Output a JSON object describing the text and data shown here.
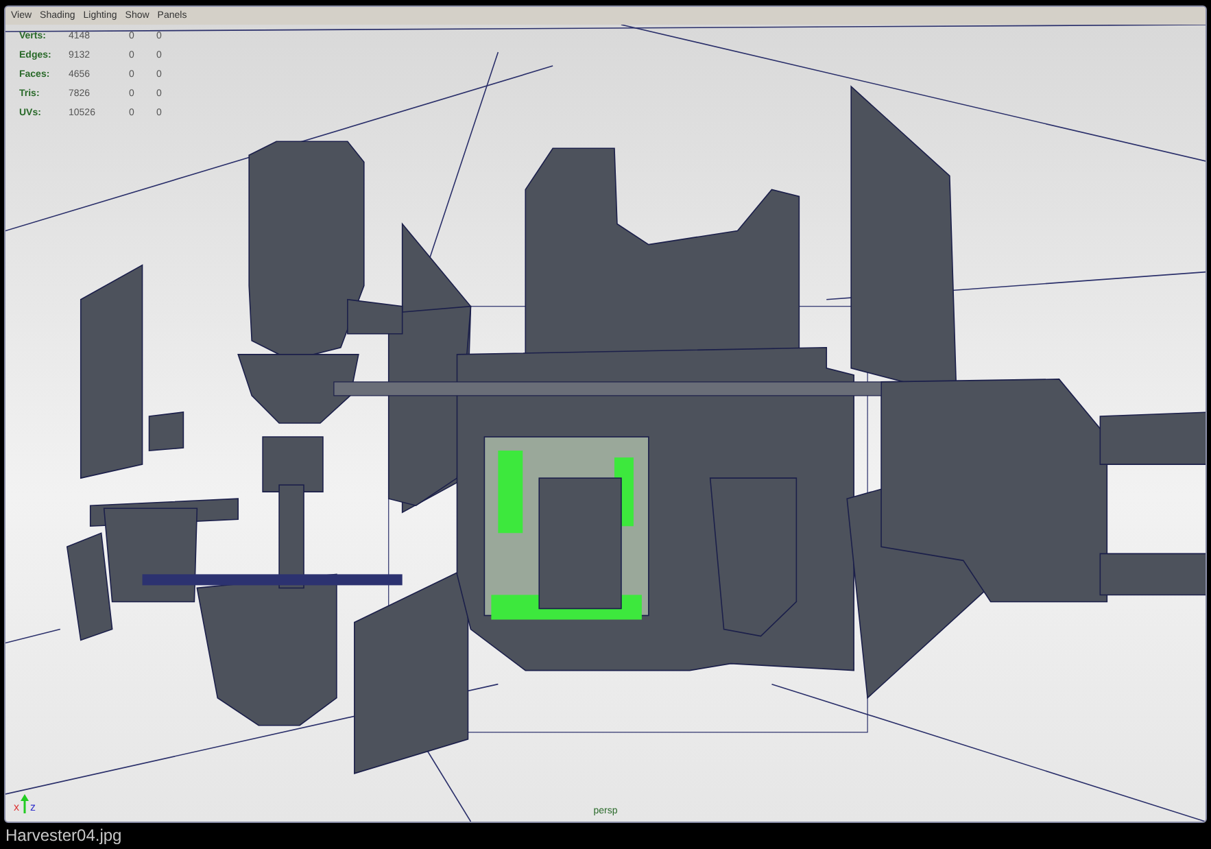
{
  "viewport": {
    "menu": [
      "View",
      "Shading",
      "Lighting",
      "Show",
      "Panels"
    ],
    "stats": [
      {
        "label": "Verts:",
        "values": [
          "4148",
          "0",
          "0"
        ]
      },
      {
        "label": "Edges:",
        "values": [
          "9132",
          "0",
          "0"
        ]
      },
      {
        "label": "Faces:",
        "values": [
          "4656",
          "0",
          "0"
        ]
      },
      {
        "label": "Tris:",
        "values": [
          "7826",
          "0",
          "0"
        ]
      },
      {
        "label": "UVs:",
        "values": [
          "10526",
          "0",
          "0"
        ]
      }
    ],
    "axis_labels": [
      "x",
      "z"
    ],
    "camera": "persp"
  },
  "caption": "Harvester04.jpg"
}
